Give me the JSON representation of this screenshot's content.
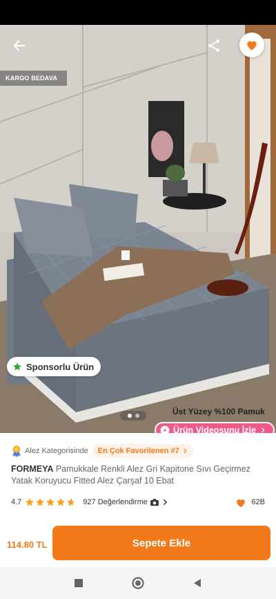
{
  "badges": {
    "kargo": "KARGO BEDAVA",
    "sponsored": "Sponsorlu Ürün"
  },
  "hero": {
    "overlay_line1": "Üst Yüzey %100 Pamuk",
    "video_button": "Ürün Videosunu İzle",
    "slides_total": 2,
    "slide_active": 1
  },
  "category": {
    "label": "Alez Kategorisinde",
    "chip": "En Çok Favorilenen #7"
  },
  "product": {
    "brand": "FORMEYA",
    "title": "Pamukkale Renkli Alez Gri Kapitone Sıvı Geçirmez Yatak Koruyucu Fitted Alez Çarşaf 10 Ebat"
  },
  "rating": {
    "score": "4.7",
    "stars": 4.7,
    "reviews": "927 Değerlendirme"
  },
  "favorites": {
    "count": "62B"
  },
  "purchase": {
    "price": "114.80 TL",
    "button": "Sepete Ekle"
  },
  "colors": {
    "accent": "#f27a1a",
    "video": "#ef5a8a",
    "star": "#f7a21b"
  },
  "icons": [
    "back-arrow-icon",
    "share-icon",
    "heart-icon",
    "star-icon",
    "play-icon",
    "chevron-right-icon",
    "camera-icon",
    "medal-icon",
    "square-nav-icon",
    "circle-nav-icon",
    "triangle-nav-icon"
  ]
}
